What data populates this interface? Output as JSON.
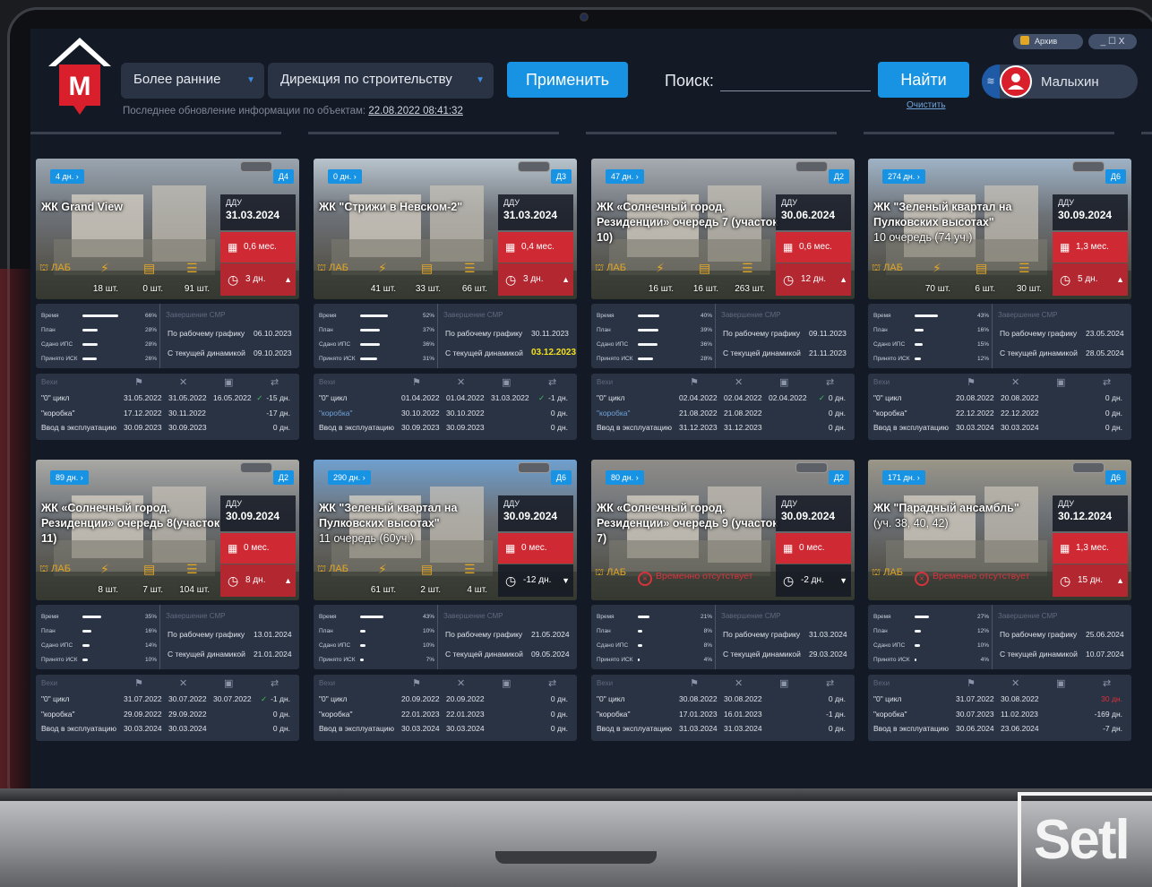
{
  "header": {
    "period_select": "Более ранние",
    "directorate_select": "Дирекция по строительству",
    "apply_button": "Применить",
    "search_label": "Поиск:",
    "search_value": "",
    "find_button": "Найти",
    "clear_link": "Очистить",
    "update_text": "Последнее обновление информации по объектам:",
    "update_date": "22.08.2022 08:41:32",
    "user_name": "Малыхин",
    "archive_label": "Архив",
    "window_controls": "_ ☐ X"
  },
  "brand": {
    "logo_letter": "M",
    "footer_brand": "Setl"
  },
  "labels": {
    "ddu": "ДДУ",
    "lab": "ЛАБ",
    "absent": "Временно отсутствует",
    "time": "Время",
    "plan": "План",
    "ips": "Сдано ИПС",
    "isk": "Принято ИСК",
    "completion": "Завершение СМР",
    "by_schedule": "По рабочему графику",
    "current": "С текущей динамикой",
    "milestones": "Вехи",
    "cycle0": "\"0\" цикл",
    "box": "\"коробка\"",
    "commission": "Ввод в эксплуатацию"
  },
  "cards": [
    {
      "days": "4 дн.",
      "tag": "Д4",
      "name": "ЖК Grand View",
      "sub": "",
      "ddu": "31.03.2024",
      "mes": "0,6 мес.",
      "dn": "3 дн.",
      "dir": "▲",
      "lab": true,
      "c1": "18 шт.",
      "c2": "0 шт.",
      "c3": "91 шт.",
      "p": [
        66,
        28,
        28,
        26
      ],
      "zav1": "06.10.2023",
      "zav2": "09.10.2023",
      "zhl": false,
      "v": [
        [
          "31.05.2022",
          "31.05.2022",
          "16.05.2022",
          "-15 дн.",
          true,
          false
        ],
        [
          "17.12.2022",
          "30.11.2022",
          "",
          "-17 дн.",
          false,
          false
        ],
        [
          "30.09.2023",
          "30.09.2023",
          "",
          "0 дн.",
          false,
          false
        ]
      ],
      "boxblue": false
    },
    {
      "days": "0 дн.",
      "tag": "Д3",
      "name": "ЖК \"Стрижи в Невском-2\"",
      "sub": "",
      "ddu": "31.03.2024",
      "mes": "0,4 мес.",
      "dn": "3 дн.",
      "dir": "▲",
      "lab": true,
      "c1": "41 шт.",
      "c2": "33 шт.",
      "c3": "66 шт.",
      "p": [
        52,
        37,
        36,
        31
      ],
      "zav1": "30.11.2023",
      "zav2": "03.12.2023",
      "zhl": true,
      "v": [
        [
          "01.04.2022",
          "01.04.2022",
          "31.03.2022",
          "-1 дн.",
          true,
          false
        ],
        [
          "30.10.2022",
          "30.10.2022",
          "",
          "0 дн.",
          false,
          false
        ],
        [
          "30.09.2023",
          "30.09.2023",
          "",
          "0 дн.",
          false,
          false
        ]
      ],
      "boxblue": true
    },
    {
      "days": "47 дн.",
      "tag": "Д2",
      "name": "ЖК «Солнечный город. Резиденции» очередь 7 (участок 10)",
      "sub": "",
      "ddu": "30.06.2024",
      "mes": "0,6 мес.",
      "dn": "12 дн.",
      "dir": "▲",
      "lab": true,
      "c1": "16 шт.",
      "c2": "16 шт.",
      "c3": "263 шт.",
      "p": [
        40,
        39,
        36,
        28
      ],
      "zav1": "09.11.2023",
      "zav2": "21.11.2023",
      "zhl": false,
      "v": [
        [
          "02.04.2022",
          "02.04.2022",
          "02.04.2022",
          "0 дн.",
          true,
          false
        ],
        [
          "21.08.2022",
          "21.08.2022",
          "",
          "0 дн.",
          false,
          false
        ],
        [
          "31.12.2023",
          "31.12.2023",
          "",
          "0 дн.",
          false,
          false
        ]
      ],
      "boxblue": true
    },
    {
      "days": "274 дн.",
      "tag": "Д6",
      "name": "ЖК \"Зеленый квартал на Пулковских высотах\"",
      "sub": "10 очередь (74 уч.)",
      "ddu": "30.09.2024",
      "mes": "1,3 мес.",
      "dn": "5 дн.",
      "dir": "▲",
      "lab": true,
      "c1": "70 шт.",
      "c2": "6 шт.",
      "c3": "30 шт.",
      "p": [
        43,
        16,
        15,
        12
      ],
      "zav1": "23.05.2024",
      "zav2": "28.05.2024",
      "zhl": false,
      "v": [
        [
          "20.08.2022",
          "20.08.2022",
          "",
          "0 дн.",
          false,
          false
        ],
        [
          "22.12.2022",
          "22.12.2022",
          "",
          "0 дн.",
          false,
          false
        ],
        [
          "30.03.2024",
          "30.03.2024",
          "",
          "0 дн.",
          false,
          false
        ]
      ],
      "boxblue": false
    },
    {
      "days": "89 дн.",
      "tag": "Д2",
      "name": "ЖК «Солнечный город. Резиденции» очередь 8(участок 11)",
      "sub": "",
      "ddu": "30.09.2024",
      "mes": "0 мес.",
      "dn": "8 дн.",
      "dir": "▲",
      "lab": true,
      "c1": "8 шт.",
      "c2": "7 шт.",
      "c3": "104 шт.",
      "p": [
        35,
        16,
        14,
        10
      ],
      "zav1": "13.01.2024",
      "zav2": "21.01.2024",
      "zhl": false,
      "v": [
        [
          "31.07.2022",
          "30.07.2022",
          "30.07.2022",
          "-1 дн.",
          true,
          false
        ],
        [
          "29.09.2022",
          "29.09.2022",
          "",
          "0 дн.",
          false,
          false
        ],
        [
          "30.03.2024",
          "30.03.2024",
          "",
          "0 дн.",
          false,
          false
        ]
      ],
      "boxblue": false
    },
    {
      "days": "290 дн.",
      "tag": "Д6",
      "name": "ЖК \"Зеленый квартал на Пулковских высотах\"",
      "sub": "11 очередь (60уч.)",
      "ddu": "30.09.2024",
      "mes": "0 мес.",
      "dn": "-12 дн.",
      "dir": "▼",
      "lab": true,
      "c1": "61 шт.",
      "c2": "2 шт.",
      "c3": "4 шт.",
      "p": [
        43,
        10,
        10,
        7
      ],
      "zav1": "21.05.2024",
      "zav2": "09.05.2024",
      "zhl": false,
      "v": [
        [
          "20.09.2022",
          "20.09.2022",
          "",
          "0 дн.",
          false,
          false
        ],
        [
          "22.01.2023",
          "22.01.2023",
          "",
          "0 дн.",
          false,
          false
        ],
        [
          "30.03.2024",
          "30.03.2024",
          "",
          "0 дн.",
          false,
          false
        ]
      ],
      "boxblue": false
    },
    {
      "days": "80 дн.",
      "tag": "Д2",
      "name": "ЖК «Солнечный город. Резиденции» очередь 9 (участок 7)",
      "sub": "",
      "ddu": "30.09.2024",
      "mes": "0 мес.",
      "dn": "-2 дн.",
      "dir": "▼",
      "lab": false,
      "c1": "",
      "c2": "",
      "c3": "",
      "p": [
        21,
        8,
        8,
        4
      ],
      "zav1": "31.03.2024",
      "zav2": "29.03.2024",
      "zhl": false,
      "v": [
        [
          "30.08.2022",
          "30.08.2022",
          "",
          "0 дн.",
          false,
          false
        ],
        [
          "17.01.2023",
          "16.01.2023",
          "",
          "-1 дн.",
          false,
          false
        ],
        [
          "31.03.2024",
          "31.03.2024",
          "",
          "0 дн.",
          false,
          false
        ]
      ],
      "boxblue": false
    },
    {
      "days": "171 дн.",
      "tag": "Д6",
      "name": "ЖК \"Парадный ансамбль\"",
      "sub": "(уч. 38, 40, 42)",
      "ddu": "30.12.2024",
      "mes": "1,3 мес.",
      "dn": "15 дн.",
      "dir": "▲",
      "lab": false,
      "c1": "",
      "c2": "",
      "c3": "",
      "p": [
        27,
        12,
        10,
        4
      ],
      "zav1": "25.06.2024",
      "zav2": "10.07.2024",
      "zhl": false,
      "v": [
        [
          "31.07.2022",
          "30.08.2022",
          "",
          "30 дн.",
          false,
          true
        ],
        [
          "30.07.2023",
          "11.02.2023",
          "",
          "-169 дн.",
          false,
          false
        ],
        [
          "30.06.2024",
          "23.06.2024",
          "",
          "-7 дн.",
          false,
          false
        ]
      ],
      "boxblue": false
    }
  ]
}
